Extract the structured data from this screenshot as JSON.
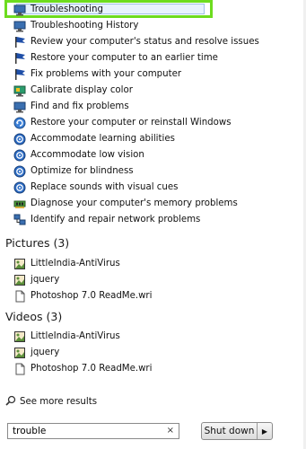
{
  "control_panel_items": [
    {
      "label": "Troubleshooting",
      "icon": "monitor-icon",
      "selected": true
    },
    {
      "label": "Troubleshooting History",
      "icon": "monitor-icon"
    },
    {
      "label": "Review your computer's status and resolve issues",
      "icon": "flag-icon"
    },
    {
      "label": "Restore your computer to an earlier time",
      "icon": "flag-icon"
    },
    {
      "label": "Fix problems with your computer",
      "icon": "flag-icon"
    },
    {
      "label": "Calibrate display color",
      "icon": "display-icon"
    },
    {
      "label": "Find and fix problems",
      "icon": "monitor-icon"
    },
    {
      "label": "Restore your computer or reinstall Windows",
      "icon": "restore-icon"
    },
    {
      "label": "Accommodate learning abilities",
      "icon": "ease-of-access-icon"
    },
    {
      "label": "Accommodate low vision",
      "icon": "ease-of-access-icon"
    },
    {
      "label": "Optimize for blindness",
      "icon": "ease-of-access-icon"
    },
    {
      "label": "Replace sounds with visual cues",
      "icon": "ease-of-access-icon"
    },
    {
      "label": "Diagnose your computer's memory problems",
      "icon": "memory-icon"
    },
    {
      "label": "Identify and repair network problems",
      "icon": "network-icon"
    }
  ],
  "pictures": {
    "title": "Pictures (3)",
    "items": [
      {
        "label": "LittleIndia-AntiVirus",
        "icon": "image-file-icon"
      },
      {
        "label": "jquery",
        "icon": "image-file-icon"
      },
      {
        "label": "Photoshop 7.0 ReadMe.wri",
        "icon": "document-icon"
      }
    ]
  },
  "videos": {
    "title": "Videos (3)",
    "items": [
      {
        "label": "LittleIndia-AntiVirus",
        "icon": "image-file-icon"
      },
      {
        "label": "jquery",
        "icon": "image-file-icon"
      },
      {
        "label": "Photoshop 7.0 ReadMe.wri",
        "icon": "document-icon"
      }
    ]
  },
  "see_more": "See more results",
  "search": {
    "value": "trouble",
    "clear": "×"
  },
  "shutdown": {
    "label": "Shut down",
    "arrow": "▶"
  },
  "colors": {
    "highlight": "#6ddc1e",
    "flag": "#1f4fa8"
  }
}
